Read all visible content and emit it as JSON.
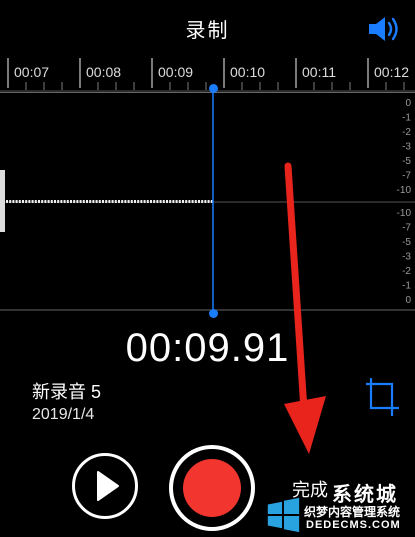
{
  "header": {
    "title": "录制"
  },
  "timeline": {
    "ticks": [
      "00:07",
      "00:08",
      "00:09",
      "00:10",
      "00:11",
      "00:12"
    ]
  },
  "level_scale": {
    "upper": [
      "0",
      "-1",
      "-2",
      "-3",
      "-5",
      "-7",
      "-10"
    ],
    "lower": [
      "-10",
      "-7",
      "-5",
      "-3",
      "-2",
      "-1",
      "0"
    ]
  },
  "recording": {
    "elapsed": "00:09.91",
    "name": "新录音 5",
    "date": "2019/1/4"
  },
  "controls": {
    "done_label": "完成"
  },
  "watermark": {
    "brand_line": "系统城",
    "site_name": "织梦内容管理系统",
    "url": "DEDECMS.COM"
  },
  "colors": {
    "accent": "#1a7cff",
    "record": "#f2352e",
    "arrow": "#e8241c"
  },
  "icons": [
    "speaker-icon",
    "play-icon",
    "record-icon",
    "crop-icon",
    "arrow-annotation"
  ]
}
